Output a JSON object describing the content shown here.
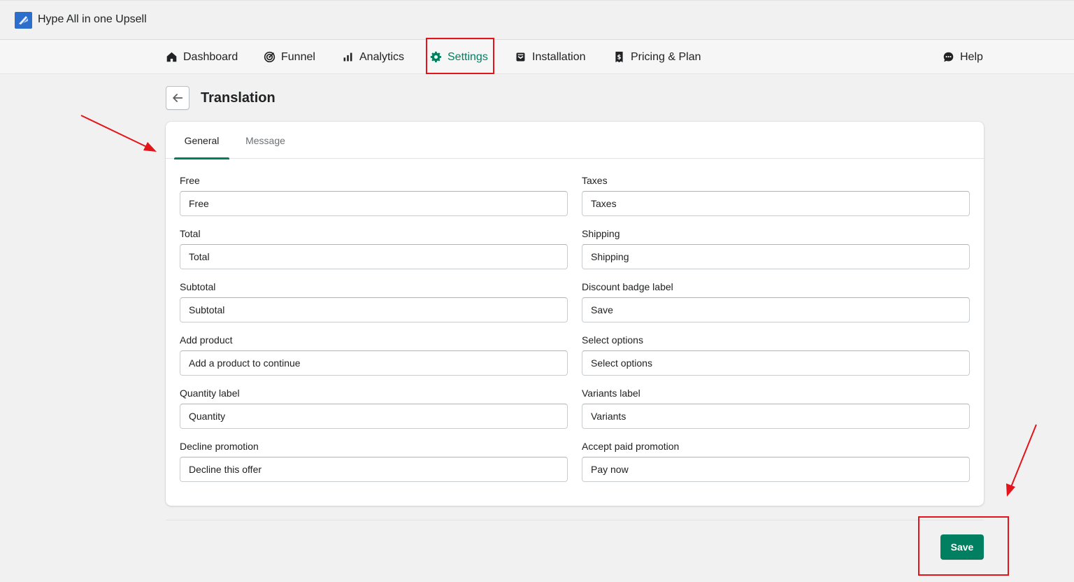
{
  "app": {
    "title": "Hype All in one Upsell"
  },
  "nav": {
    "items": [
      {
        "label": "Dashboard",
        "icon": "home-icon"
      },
      {
        "label": "Funnel",
        "icon": "funnel-target-icon"
      },
      {
        "label": "Analytics",
        "icon": "bar-chart-icon"
      },
      {
        "label": "Settings",
        "icon": "gear-icon"
      },
      {
        "label": "Installation",
        "icon": "install-icon"
      },
      {
        "label": "Pricing & Plan",
        "icon": "dollar-receipt-icon"
      }
    ],
    "help": {
      "label": "Help",
      "icon": "chat-bubble-icon"
    },
    "active": "Settings"
  },
  "page": {
    "title": "Translation"
  },
  "tabs": [
    {
      "label": "General",
      "active": true
    },
    {
      "label": "Message",
      "active": false
    }
  ],
  "fields": {
    "free": {
      "label": "Free",
      "value": "Free"
    },
    "taxes": {
      "label": "Taxes",
      "value": "Taxes"
    },
    "total": {
      "label": "Total",
      "value": "Total"
    },
    "shipping": {
      "label": "Shipping",
      "value": "Shipping"
    },
    "subtotal": {
      "label": "Subtotal",
      "value": "Subtotal"
    },
    "discount_badge": {
      "label": "Discount badge label",
      "value": "Save"
    },
    "add_product": {
      "label": "Add product",
      "value": "Add a product to continue"
    },
    "select_options": {
      "label": "Select options",
      "value": "Select options"
    },
    "quantity": {
      "label": "Quantity label",
      "value": "Quantity"
    },
    "variants": {
      "label": "Variants label",
      "value": "Variants"
    },
    "decline": {
      "label": "Decline promotion",
      "value": "Decline this offer"
    },
    "accept_paid": {
      "label": "Accept paid promotion",
      "value": "Pay now"
    }
  },
  "actions": {
    "save_label": "Save"
  },
  "colors": {
    "accent": "#008060",
    "annotation": "#e5131a",
    "background": "#f1f1f1"
  }
}
